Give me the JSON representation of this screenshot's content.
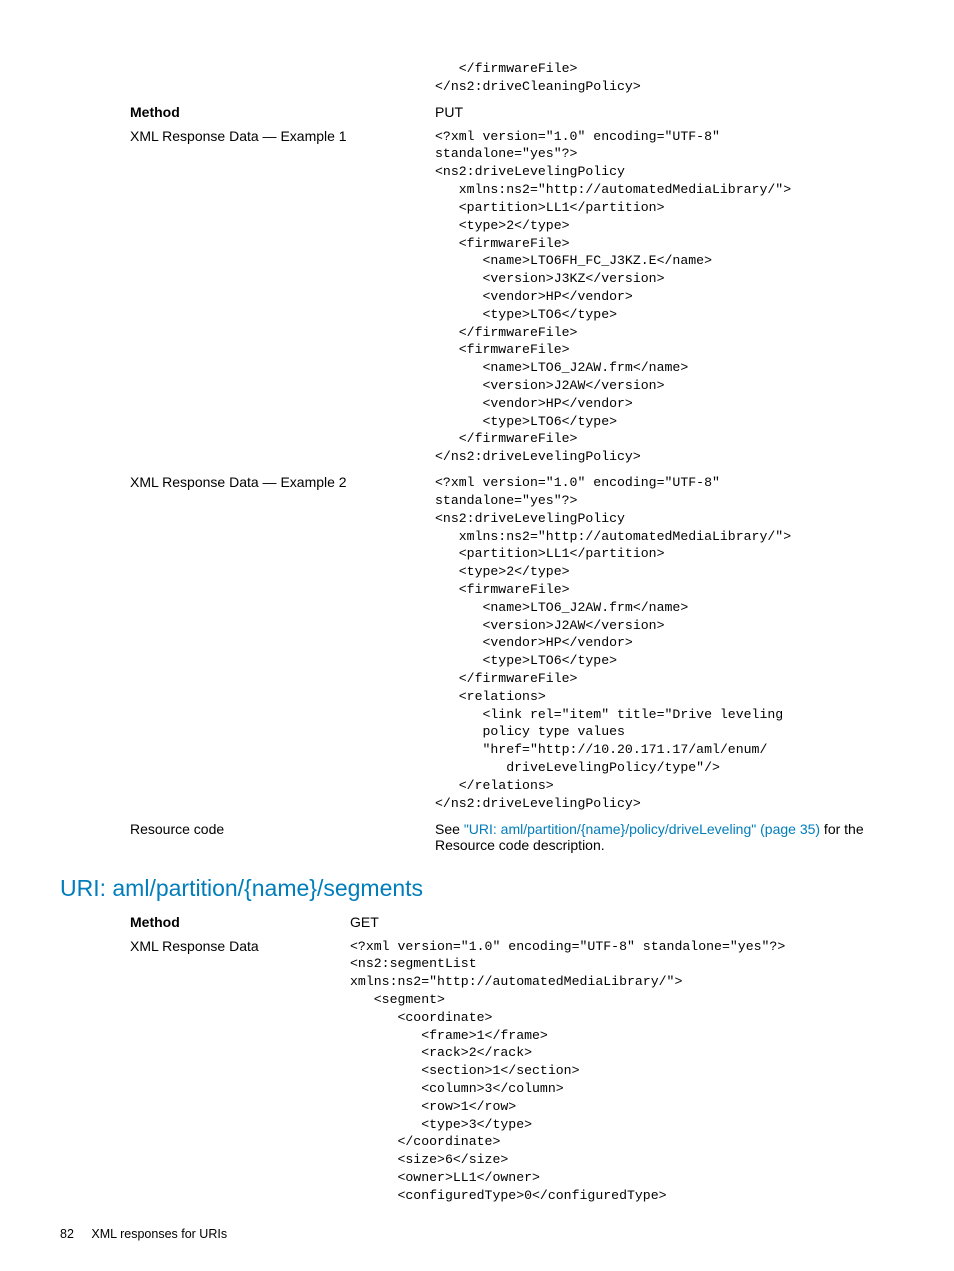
{
  "section1": {
    "pre_code": "   </firmwareFile>\n</ns2:driveCleaningPolicy>",
    "rows": [
      {
        "label": "Method",
        "label_bold": true,
        "value_type": "text",
        "value": "PUT"
      },
      {
        "label": "XML Response Data — Example 1",
        "label_bold": false,
        "value_type": "code",
        "value": "<?xml version=\"1.0\" encoding=\"UTF-8\"\nstandalone=\"yes\"?>\n<ns2:driveLevelingPolicy\n   xmlns:ns2=\"http://automatedMediaLibrary/\">\n   <partition>LL1</partition>\n   <type>2</type>\n   <firmwareFile>\n      <name>LTO6FH_FC_J3KZ.E</name>\n      <version>J3KZ</version>\n      <vendor>HP</vendor>\n      <type>LTO6</type>\n   </firmwareFile>\n   <firmwareFile>\n      <name>LTO6_J2AW.frm</name>\n      <version>J2AW</version>\n      <vendor>HP</vendor>\n      <type>LTO6</type>\n   </firmwareFile>\n</ns2:driveLevelingPolicy>"
      },
      {
        "label": "XML Response Data — Example 2",
        "label_bold": false,
        "value_type": "code",
        "value": "<?xml version=\"1.0\" encoding=\"UTF-8\"\nstandalone=\"yes\"?>\n<ns2:driveLevelingPolicy\n   xmlns:ns2=\"http://automatedMediaLibrary/\">\n   <partition>LL1</partition>\n   <type>2</type>\n   <firmwareFile>\n      <name>LTO6_J2AW.frm</name>\n      <version>J2AW</version>\n      <vendor>HP</vendor>\n      <type>LTO6</type>\n   </firmwareFile>\n   <relations>\n      <link rel=\"item\" title=\"Drive leveling\n      policy type values\n      \"href=\"http://10.20.171.17/aml/enum/\n         driveLevelingPolicy/type\"/>\n   </relations>\n</ns2:driveLevelingPolicy>"
      },
      {
        "label": "Resource code",
        "label_bold": false,
        "value_type": "resource",
        "value_prefix": "See ",
        "value_link": "\"URI: aml/partition/{name}/policy/driveLeveling\" (page 35)",
        "value_suffix": " for the Resource code description."
      }
    ]
  },
  "heading2": "URI: aml/partition/{name}/segments",
  "section2": {
    "rows": [
      {
        "label": "Method",
        "label_bold": true,
        "value_type": "text",
        "value": "GET"
      },
      {
        "label": "XML Response Data",
        "label_bold": false,
        "value_type": "code",
        "value": "<?xml version=\"1.0\" encoding=\"UTF-8\" standalone=\"yes\"?>\n<ns2:segmentList\nxmlns:ns2=\"http://automatedMediaLibrary/\">\n   <segment>\n      <coordinate>\n         <frame>1</frame>\n         <rack>2</rack>\n         <section>1</section>\n         <column>3</column>\n         <row>1</row>\n         <type>3</type>\n      </coordinate>\n      <size>6</size>\n      <owner>LL1</owner>\n      <configuredType>0</configuredType>"
      }
    ]
  },
  "footer": {
    "page": "82",
    "title": "XML responses for URIs"
  }
}
